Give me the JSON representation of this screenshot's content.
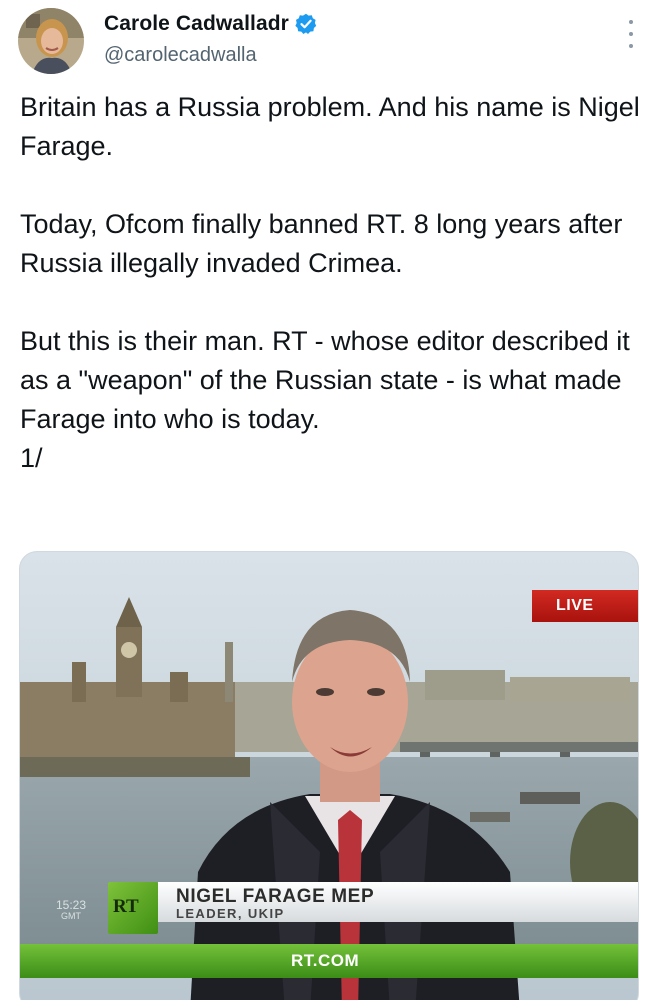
{
  "author": {
    "display_name": "Carole Cadwalladr",
    "handle": "@carolecadwalla",
    "verified": true,
    "verified_color": "#1d9bf0"
  },
  "icons": {
    "verified": "verified-badge-icon",
    "more": "more-options-icon"
  },
  "tweet": {
    "paragraphs": [
      "Britain has a Russia problem. And his name is Nigel Farage.",
      "Today, Ofcom finally banned RT. 8 long years after Russia illegally invaded Crimea.",
      "But this is their man. RT - whose editor described it as a \"weapon\" of the Russian state - is what made Farage into who is today.",
      "1/"
    ]
  },
  "media": {
    "live_label": "LIVE",
    "clock_time": "15:23",
    "clock_zone": "GMT",
    "logo_text": "RT",
    "lower_third_name": "NIGEL FARAGE MEP",
    "lower_third_title": "LEADER, UKIP",
    "footer_url": "RT.COM"
  },
  "colors": {
    "text": "#0f1419",
    "secondary_text": "#536471",
    "live_red": "#c51f19",
    "rt_green": "#5aaa2a"
  }
}
